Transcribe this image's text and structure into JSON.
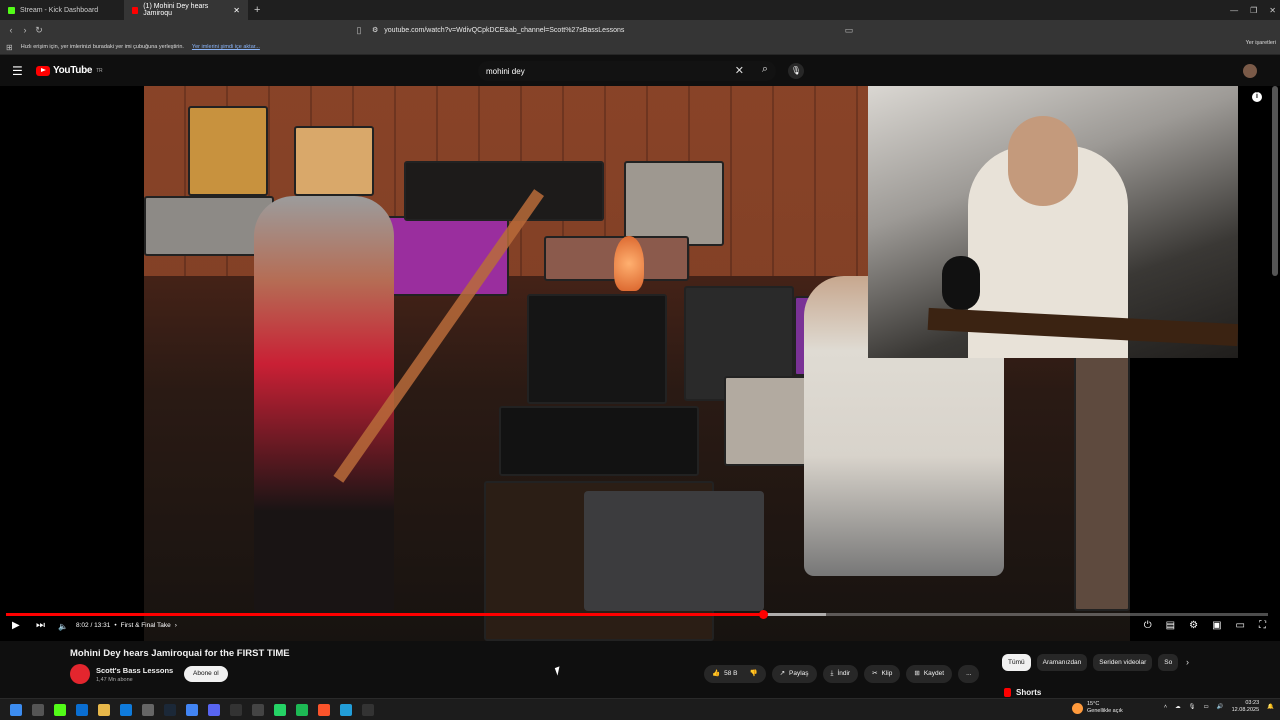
{
  "browser": {
    "tabs": [
      {
        "title": "Stream - Kick Dashboard",
        "color": "#53fc18"
      },
      {
        "title": "(1) Mohini Dey hears Jamiroqu",
        "color": "#ff0000"
      }
    ],
    "new_tab": "+",
    "url": "youtube.com/watch?v=WdivQCpkDCE&ab_channel=Scott%27sBassLessons",
    "bookmarks_hint": "Hızlı erişim için, yer imlerinizi buradaki yer imi çubuğuna yerleştirin.",
    "bookmarks_link": "Yer imlerini şimdi içe aktar...",
    "bookmarks_right": "Yer işaretleri"
  },
  "youtube": {
    "logo_text": "YouTube",
    "logo_region": "TR",
    "search_value": "mohini dey"
  },
  "player": {
    "time": "8:02 / 13:31",
    "chapter": "First & Final Take",
    "progress_played": 0.6,
    "progress_loaded": 0.65
  },
  "video": {
    "title": "Mohini Dey hears Jamiroquai for the FIRST TIME",
    "channel": "Scott's Bass Lessons",
    "subscribers": "1,47 Mn abone",
    "subscribe_label": "Abone ol",
    "likes": "58 B",
    "share": "Paylaş",
    "download": "İndir",
    "clip": "Klip",
    "save": "Kaydet",
    "more": "..."
  },
  "chips": [
    "Tümü",
    "Aramanızdan",
    "Seriden videolar",
    "So"
  ],
  "shorts_label": "Shorts",
  "taskbar": {
    "weather_temp": "15°C",
    "weather_desc": "Genellikle açık",
    "time": "03:23",
    "date": "12.08.2025"
  }
}
